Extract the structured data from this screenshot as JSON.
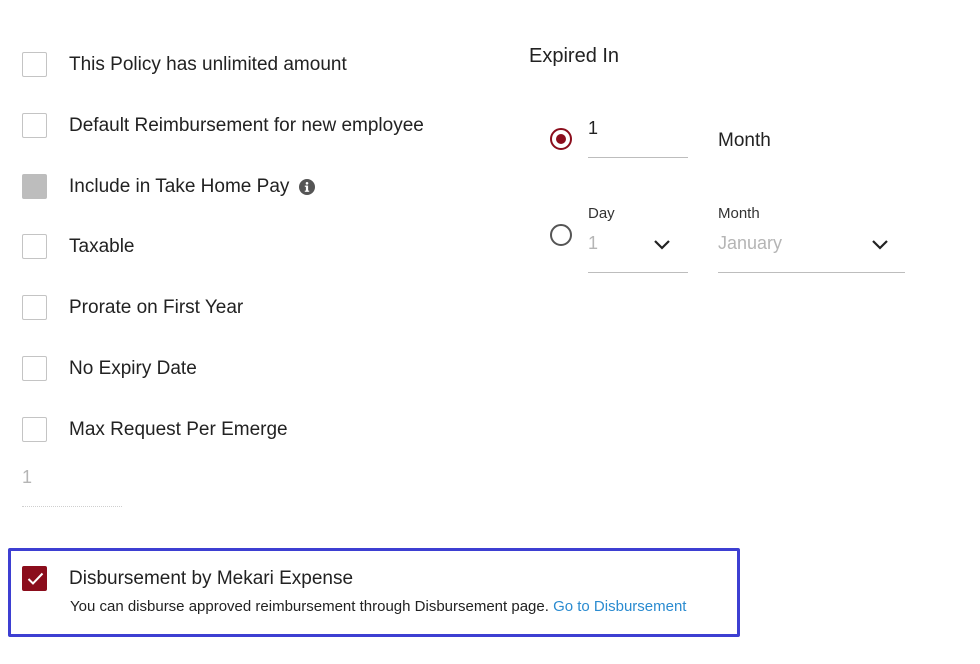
{
  "policy_options": [
    {
      "label": "This Policy has unlimited amount",
      "state": "unchecked"
    },
    {
      "label": "Default Reimbursement for new employee",
      "state": "unchecked"
    },
    {
      "label": "Include in Take Home Pay",
      "state": "disabled",
      "icon": "info-icon"
    },
    {
      "label": "Taxable",
      "state": "unchecked"
    },
    {
      "label": "Prorate on First Year",
      "state": "unchecked"
    },
    {
      "label": "No Expiry Date",
      "state": "unchecked"
    },
    {
      "label": "Max Request Per Emerge",
      "state": "unchecked"
    }
  ],
  "max_request_value": "1",
  "expired_in": {
    "title": "Expired In",
    "option_month": {
      "selected": true,
      "value": "1",
      "unit_label": "Month"
    },
    "option_date": {
      "selected": false,
      "day_label": "Day",
      "day_value": "1",
      "month_label": "Month",
      "month_value": "January"
    }
  },
  "disbursement": {
    "checked": true,
    "label": "Disbursement by Mekari Expense",
    "description": "You can disburse approved reimbursement through Disbursement page.",
    "link_text": "Go to Disbursement"
  },
  "colors": {
    "accent": "#8b0d1c",
    "highlight_border": "#3d3fd2",
    "link": "#2a8bd0",
    "disabled": "#bdbdbd"
  }
}
